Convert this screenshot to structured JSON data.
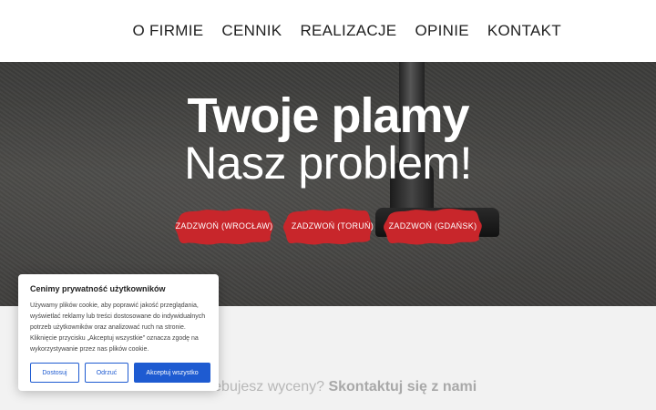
{
  "nav": {
    "items": [
      "O FIRMIE",
      "CENNIK",
      "REALIZACJE",
      "OPINIE",
      "KONTAKT"
    ]
  },
  "hero": {
    "title": "Twoje plamy",
    "subtitle": "Nasz problem!",
    "buttons": [
      "ZADZWOŃ (WROCŁAW)",
      "ZADZWOŃ (TORUŃ)",
      "ZADZWOŃ (GDAŃSK)"
    ],
    "button_color": "#c8262b"
  },
  "cta": {
    "prefix": "Potrzebujesz wyceny?",
    "link": "Skontaktuj się z nami"
  },
  "cookie": {
    "title": "Cenimy prywatność użytkowników",
    "text": "Używamy plików cookie, aby poprawić jakość przeglądania, wyświetlać reklamy lub treści dostosowane do indywidualnych potrzeb użytkowników oraz analizować ruch na stronie. Kliknięcie przycisku „Akceptuj wszystkie” oznacza zgodę na wykorzystywanie przez nas plików cookie.",
    "customize": "Dostosuj",
    "reject": "Odrzuć",
    "accept": "Akceptuj wszystko",
    "accent": "#1e5bd1"
  }
}
